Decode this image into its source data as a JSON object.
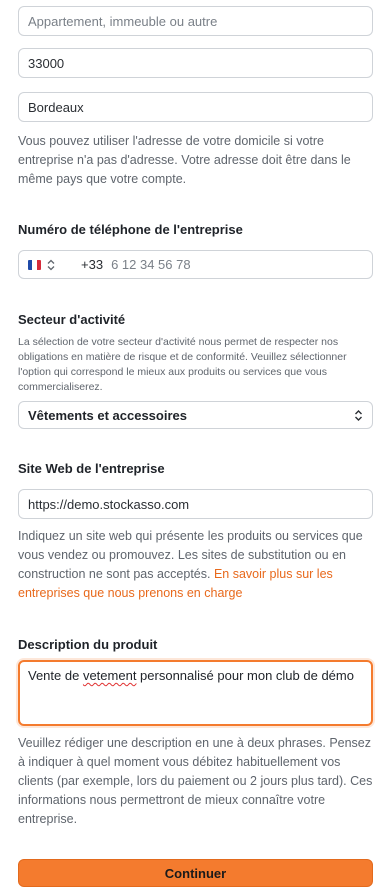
{
  "address": {
    "line2_placeholder": "Appartement, immeuble ou autre",
    "postal_code": "33000",
    "city": "Bordeaux",
    "help": "Vous pouvez utiliser l'adresse de votre domicile si votre entreprise n'a pas d'adresse. Votre adresse doit être dans le même pays que votre compte."
  },
  "phone": {
    "label": "Numéro de téléphone de l'entreprise",
    "country_code": "+33",
    "placeholder": "6 12 34 56 78",
    "flag_colors": [
      "#1f4aa8",
      "#ffffff",
      "#d52b3b"
    ]
  },
  "sector": {
    "label": "Secteur d'activité",
    "help": "La sélection de votre secteur d'activité nous permet de respecter nos obligations en matière de risque et de conformité. Veuillez sélectionner l'option qui correspond le mieux aux produits ou services que vous commercialiserez.",
    "selected": "Vêtements et accessoires"
  },
  "website": {
    "label": "Site Web de l'entreprise",
    "value": "https://demo.stockasso.com",
    "help": "Indiquez un site web qui présente les produits ou services que vous vendez ou promouvez. Les sites de substitution ou en construction ne sont pas acceptés.",
    "link": "En savoir plus sur les entreprises que nous prenons en charge"
  },
  "description": {
    "label": "Description du produit",
    "value_before": "Vente de ",
    "value_misspelled": "vetement",
    "value_after": " personnalisé pour mon club de démo",
    "help": "Veuillez rédiger une description en une à deux phrases. Pensez à indiquer à quel moment vous débitez habituellement vos clients (par exemple, lors du paiement ou 2 jours plus tard). Ces informations nous permettront de mieux connaître votre entreprise."
  },
  "actions": {
    "continue_label": "Continuer"
  },
  "colors": {
    "accent": "#f47b2e",
    "link": "#e8691c",
    "spellcheck": "#e03131"
  }
}
